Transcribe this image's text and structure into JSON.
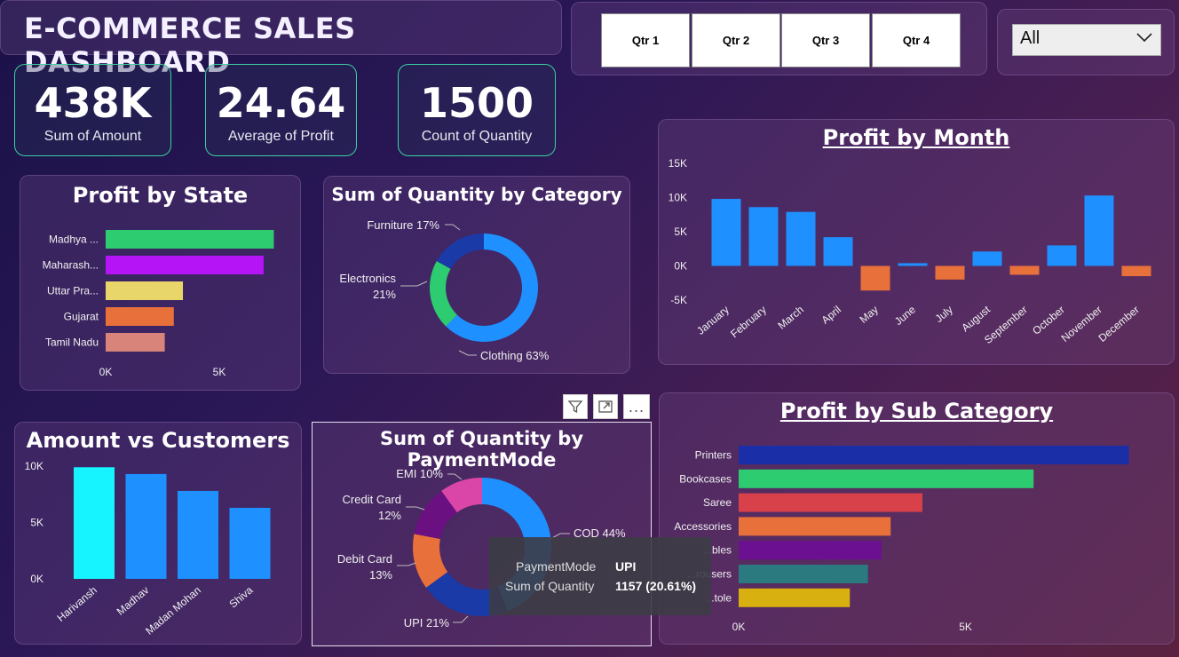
{
  "title": "E-COMMERCE SALES DASHBOARD",
  "quarters": [
    "Qtr 1",
    "Qtr 2",
    "Qtr 3",
    "Qtr 4"
  ],
  "slicer": {
    "value": "All"
  },
  "kpis": [
    {
      "value": "438K",
      "label": "Sum of Amount"
    },
    {
      "value": "24.64",
      "label": "Average of Profit"
    },
    {
      "value": "1500",
      "label": "Count of Quantity"
    }
  ],
  "tooltip": {
    "label1": "PaymentMode",
    "value1": "UPI",
    "label2": "Sum of Quantity",
    "value2": "1157 (20.61%)"
  },
  "more_dots": "...",
  "colors": {
    "accent_teal": "#3ad1a0",
    "bar_blue": "#1e90ff",
    "bar_orange": "#e8703a"
  },
  "chart_data": [
    {
      "id": "profit_by_state",
      "type": "bar",
      "orientation": "horizontal",
      "title": "Profit by State",
      "categories": [
        "Madhya ...",
        "Maharash...",
        "Uttar Pra...",
        "Gujarat",
        "Tamil Nadu"
      ],
      "values": [
        7400,
        6950,
        3400,
        3000,
        2600
      ],
      "colors": [
        "#2ecc71",
        "#b514f7",
        "#e9d66b",
        "#e8703a",
        "#d8847a"
      ],
      "xticks": [
        "0K",
        "5K"
      ],
      "xlim": [
        0,
        7500
      ]
    },
    {
      "id": "quantity_by_category",
      "type": "pie",
      "donut": true,
      "title": "Sum of Quantity by Category",
      "labels": [
        "Clothing",
        "Electronics",
        "Furniture"
      ],
      "values": [
        63,
        21,
        17
      ],
      "display_labels": [
        "Clothing 63%",
        "Electronics",
        "21%",
        "Furniture 17%"
      ],
      "colors": [
        "#1e90ff",
        "#2ecc71",
        "#1a3aa8"
      ]
    },
    {
      "id": "profit_by_month",
      "type": "bar",
      "title": "Profit by Month",
      "categories": [
        "January",
        "February",
        "March",
        "April",
        "May",
        "June",
        "July",
        "August",
        "September",
        "October",
        "November",
        "December"
      ],
      "values": [
        9800,
        8600,
        7900,
        4200,
        -3600,
        400,
        -2000,
        2100,
        -1300,
        3000,
        10300,
        -1500
      ],
      "yticks": [
        "15K",
        "10K",
        "5K",
        "0K",
        "-5K"
      ],
      "ylim": [
        -5000,
        15000
      ],
      "positive_color": "#1e90ff",
      "negative_color": "#e8703a"
    },
    {
      "id": "amount_vs_customers",
      "type": "bar",
      "title": "Amount vs Customers",
      "categories": [
        "Harivansh",
        "Madhav",
        "Madan Mohan",
        "Shiva"
      ],
      "values": [
        9900,
        9300,
        7800,
        6300
      ],
      "colors": [
        "#16f5ff",
        "#1e90ff",
        "#1e90ff",
        "#1e90ff"
      ],
      "yticks": [
        "10K",
        "5K",
        "0K"
      ],
      "ylim": [
        0,
        10000
      ]
    },
    {
      "id": "quantity_by_paymentmode",
      "type": "pie",
      "donut": true,
      "title": "Sum of Quantity by PaymentMode",
      "labels": [
        "COD",
        "UPI",
        "Debit Card",
        "Credit Card",
        "EMI"
      ],
      "values": [
        44,
        21,
        13,
        12,
        10
      ],
      "display_labels": [
        "COD 44%",
        "UPI 21%",
        "Debit Card",
        "13%",
        "Credit Card",
        "12%",
        "EMI 10%"
      ],
      "colors": [
        "#1e90ff",
        "#1a3aa8",
        "#e8703a",
        "#6a1080",
        "#d946a8"
      ]
    },
    {
      "id": "profit_by_subcategory",
      "type": "bar",
      "orientation": "horizontal",
      "title": "Profit by Sub Category",
      "categories": [
        "Printers",
        "Bookcases",
        "Saree",
        "Accessories",
        "Tables",
        "Trousers",
        "Stole"
      ],
      "display_categories": [
        "Printers",
        "Bookcases",
        "Saree",
        "Accessories",
        "...bles",
        "...rousers",
        "...tole"
      ],
      "values": [
        8600,
        6500,
        4050,
        3350,
        3150,
        2850,
        2450
      ],
      "colors": [
        "#1a2ea8",
        "#2ecc71",
        "#d8404a",
        "#e8703a",
        "#6a1090",
        "#2a7a80",
        "#d8b010"
      ],
      "xticks": [
        "0K",
        "5K"
      ],
      "xlim": [
        0,
        9000
      ]
    }
  ]
}
